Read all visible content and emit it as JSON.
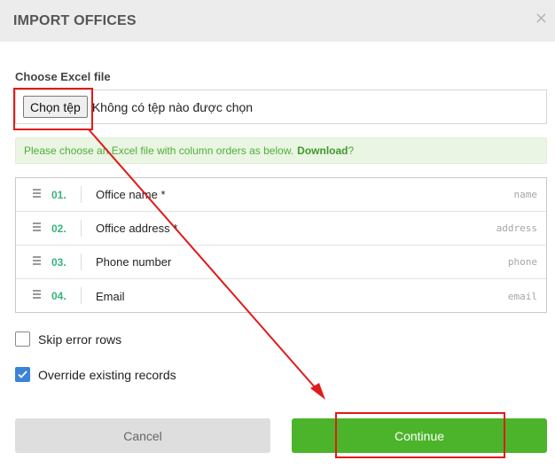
{
  "modal": {
    "title": "IMPORT OFFICES",
    "close_symbol": "×"
  },
  "file_picker": {
    "label": "Choose Excel file",
    "button_label": "Chọn tệp",
    "status_text": "Không có tệp nào được chọn"
  },
  "info": {
    "text": "Please choose an Excel file with column orders as below.",
    "link_label": "Download",
    "suffix": "?"
  },
  "columns": [
    {
      "number": "01.",
      "name": "Office name *",
      "key": "name"
    },
    {
      "number": "02.",
      "name": "Office address *",
      "key": "address"
    },
    {
      "number": "03.",
      "name": "Phone number",
      "key": "phone"
    },
    {
      "number": "04.",
      "name": "Email",
      "key": "email"
    }
  ],
  "options": {
    "skip_errors": {
      "label": "Skip error rows",
      "checked": false
    },
    "override": {
      "label": "Override existing records",
      "checked": true
    }
  },
  "buttons": {
    "cancel_label": "Cancel",
    "continue_label": "Continue"
  },
  "colors": {
    "accent_green": "#4cb42b",
    "column_number": "#36b37e",
    "checkbox_blue": "#3b83d6",
    "annotation_red": "#e01b1b"
  }
}
